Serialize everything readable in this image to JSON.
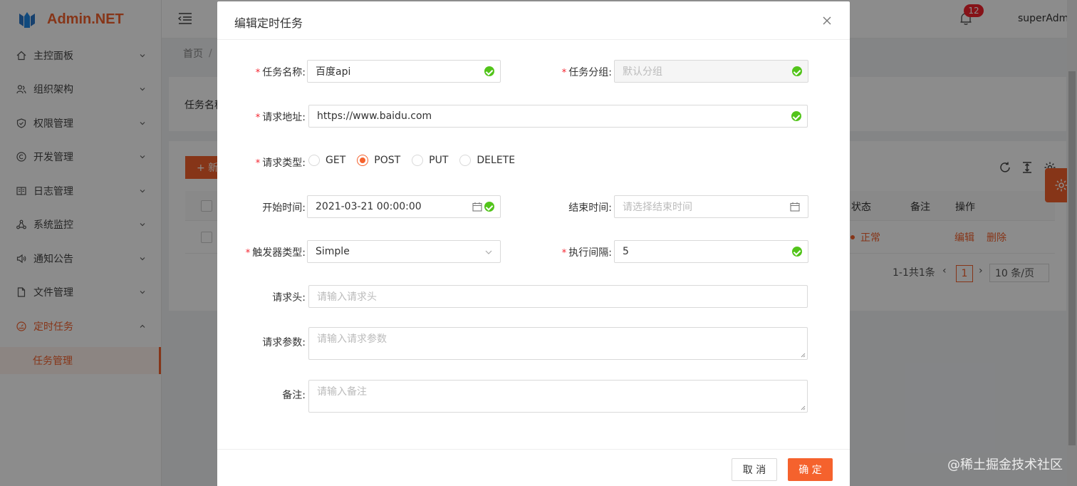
{
  "brand": {
    "name": "Admin.NET"
  },
  "sidebar": {
    "items": [
      {
        "label": "主控面板",
        "icon": "home-icon"
      },
      {
        "label": "组织架构",
        "icon": "team-icon"
      },
      {
        "label": "权限管理",
        "icon": "shield-icon"
      },
      {
        "label": "开发管理",
        "icon": "copyright-icon"
      },
      {
        "label": "日志管理",
        "icon": "book-icon"
      },
      {
        "label": "系统监控",
        "icon": "cluster-icon"
      },
      {
        "label": "通知公告",
        "icon": "sound-icon"
      },
      {
        "label": "文件管理",
        "icon": "file-icon"
      },
      {
        "label": "定时任务",
        "icon": "dashboard-icon"
      }
    ],
    "sub_item": "任务管理"
  },
  "header": {
    "notification_count": "12",
    "username": "superAdmin"
  },
  "breadcrumb": {
    "home": "首页",
    "sep": "/"
  },
  "background": {
    "search_label": "任务名称",
    "add_button": "+ 新",
    "columns": {
      "status": "状态",
      "remark": "备注",
      "action": "操作"
    },
    "row": {
      "status": "正常",
      "edit": "编辑",
      "delete": "删除"
    },
    "pagination": {
      "total": "1-1共1条",
      "page": "1",
      "page_size": "10 条/页"
    }
  },
  "modal": {
    "title": "编辑定时任务",
    "fields": {
      "task_name": {
        "label": "任务名称:",
        "value": "百度api"
      },
      "task_group": {
        "label": "任务分组:",
        "placeholder": "默认分组"
      },
      "request_url": {
        "label": "请求地址:",
        "value": "https://www.baidu.com"
      },
      "request_type": {
        "label": "请求类型:",
        "options": [
          "GET",
          "POST",
          "PUT",
          "DELETE"
        ],
        "selected": "POST"
      },
      "start_time": {
        "label": "开始时间:",
        "value": "2021-03-21 00:00:00"
      },
      "end_time": {
        "label": "结束时间:",
        "placeholder": "请选择结束时间"
      },
      "trigger_type": {
        "label": "触发器类型:",
        "value": "Simple"
      },
      "interval": {
        "label": "执行间隔:",
        "value": "5"
      },
      "headers": {
        "label": "请求头:",
        "placeholder": "请输入请求头"
      },
      "params": {
        "label": "请求参数:",
        "placeholder": "请输入请求参数"
      },
      "remark": {
        "label": "备注:",
        "placeholder": "请输入备注"
      }
    },
    "cancel": "取 消",
    "ok": "确 定"
  },
  "watermark": "@稀土掘金技术社区",
  "colors": {
    "accent": "#f5622d",
    "success": "#52c41a",
    "required": "#f5222d"
  }
}
